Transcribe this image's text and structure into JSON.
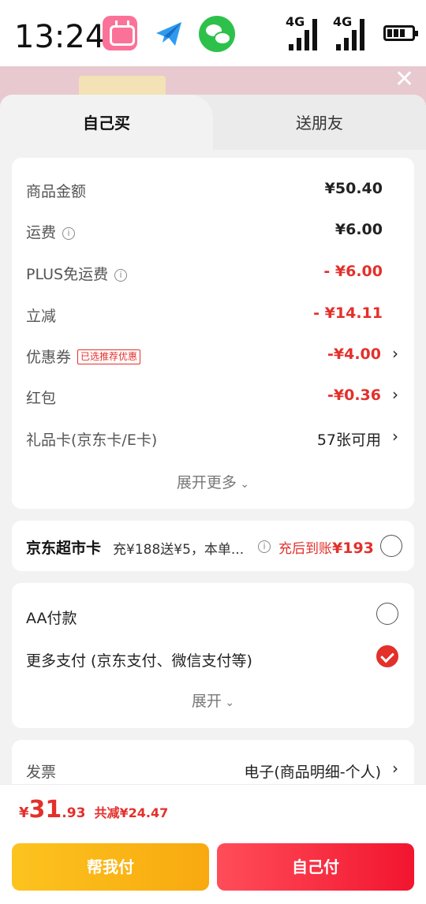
{
  "status_bar": {
    "time": "13:24",
    "network1": "4G",
    "network2": "4G"
  },
  "tabs": [
    {
      "label": "自己买"
    },
    {
      "label": "送朋友"
    }
  ],
  "price_card": {
    "rows": [
      {
        "label": "商品金额",
        "value": "¥50.40"
      },
      {
        "label": "运费",
        "value": "¥6.00"
      },
      {
        "label": "PLUS免运费",
        "value": "- ¥6.00"
      },
      {
        "label": "立减",
        "value": "- ¥14.11"
      },
      {
        "label": "优惠券",
        "tag": "已选推荐优惠",
        "value": "-¥4.00"
      },
      {
        "label": "红包",
        "value": "-¥0.36"
      },
      {
        "label": "礼品卡(京东卡/E卡)",
        "value": "57张可用"
      }
    ],
    "expand": "展开更多"
  },
  "card_promo": {
    "title": "京东超市卡",
    "desc": "充¥188送¥5，本单...",
    "result_prefix": "充后到账",
    "result_amount": "¥193"
  },
  "payment": {
    "aa": "AA付款",
    "more": "更多支付 (京东支付、微信支付等)",
    "expand": "展开"
  },
  "invoice": {
    "label": "发票",
    "value": "电子(商品明细-个人)"
  },
  "footer": {
    "currency": "¥",
    "total_int": "31",
    "total_dec": ".93",
    "saved": "共减¥24.47",
    "help_button": "帮我付",
    "pay_button": "自己付"
  }
}
